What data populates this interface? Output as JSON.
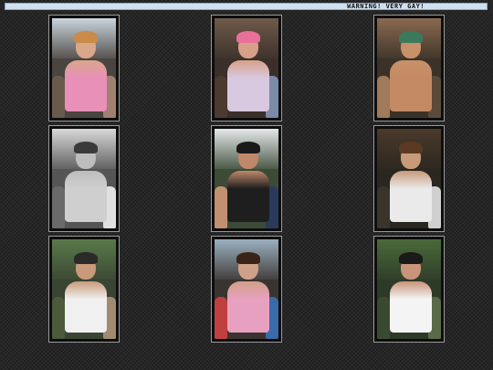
{
  "banner": {
    "text": "WARNING! VERY GAY!"
  },
  "thumbnails": [
    {
      "sky": "#c9d4dc",
      "crowd": "#4a4540",
      "skin": "#d9a78a",
      "hair": "#c98a4a",
      "shirt": "#e890b8",
      "left": "#6a5a4e",
      "right": "#a08070"
    },
    {
      "sky": "#6e5a4a",
      "crowd": "#3a2f2a",
      "skin": "#d8a088",
      "hair": "#e8709a",
      "shirt": "#d8c8e0",
      "left": "#4a3a30",
      "right": "#7a8aa8"
    },
    {
      "sky": "#8a6a50",
      "crowd": "#3a3228",
      "skin": "#c8916a",
      "hair": "#3a7a5a",
      "shirt": "#c48a64",
      "left": "#a07a5a",
      "right": "#5a4a3a"
    },
    {
      "sky": "#d8d8d8",
      "crowd": "#555555",
      "skin": "#bdbdbd",
      "hair": "#3a3a3a",
      "shirt": "#cfcfcf",
      "left": "#6a6a6a",
      "right": "#e0e0e0"
    },
    {
      "sky": "#e4e8ea",
      "crowd": "#3c4a36",
      "skin": "#c0886a",
      "hair": "#1a1a1a",
      "shirt": "#1e1e1e",
      "left": "#c09070",
      "right": "#2a3a5a"
    },
    {
      "sky": "#4a3a2a",
      "crowd": "#2a2620",
      "skin": "#c89a7a",
      "hair": "#5a3a22",
      "shirt": "#eaeaea",
      "left": "#3a342c",
      "right": "#d0d0d0"
    },
    {
      "sky": "#5a7a4a",
      "crowd": "#3a4432",
      "skin": "#c89a7a",
      "hair": "#2a2a2a",
      "shirt": "#f0f0f0",
      "left": "#4a5a3a",
      "right": "#a08a70"
    },
    {
      "sky": "#9ab0c0",
      "crowd": "#3a3430",
      "skin": "#d0a088",
      "hair": "#3a2418",
      "shirt": "#e8a0c0",
      "left": "#c04040",
      "right": "#3a6aa8"
    },
    {
      "sky": "#4a6a3a",
      "crowd": "#2e3a28",
      "skin": "#c8947a",
      "hair": "#1a1a1a",
      "shirt": "#f4f4f4",
      "left": "#3a4a30",
      "right": "#5a6a48"
    }
  ],
  "labels": {
    "thumb_title": "photo thumbnail"
  }
}
